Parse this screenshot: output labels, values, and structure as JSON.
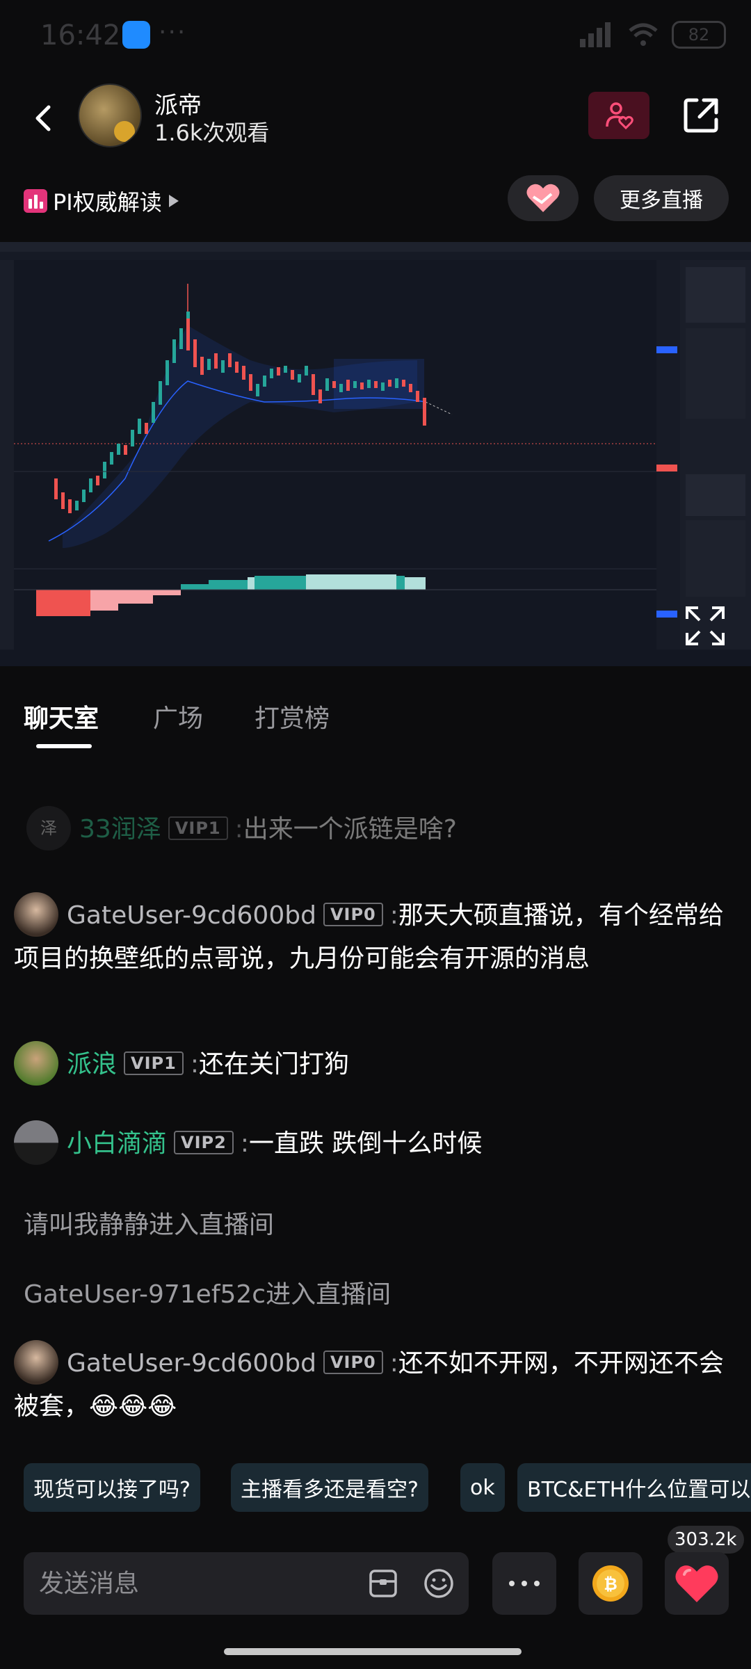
{
  "status_bar": {
    "time": "16:42",
    "more": "···",
    "battery": "82"
  },
  "header": {
    "host_name": "派帝",
    "view_count": "1.6k次观看"
  },
  "topic": {
    "label": "PI权威解读"
  },
  "buttons": {
    "more_live": "更多直播"
  },
  "tabs": [
    "聊天室",
    "广场",
    "打赏榜"
  ],
  "chat": {
    "messages": [
      {
        "avatar_text": "泽",
        "user": "33润泽",
        "vip": "VIP1",
        "sep": ":",
        "text": "出来一个派链是啥?"
      },
      {
        "user": "GateUser-9cd600bd",
        "vip": "VIP0",
        "sep": ":",
        "text": "那天大硕直播说，有个经常给项目的换壁纸的点哥说，九月份可能会有开源的消息"
      },
      {
        "user": "派浪",
        "vip": "VIP1",
        "sep": ":",
        "text": "还在关门打狗"
      },
      {
        "user": "小白滴滴",
        "vip": "VIP2",
        "sep": ":",
        "text": "一直跌 跌倒十么时候"
      },
      {
        "text": "请叫我静静进入直播间"
      },
      {
        "text": "GateUser-971ef52c进入直播间"
      },
      {
        "user": "GateUser-9cd600bd",
        "vip": "VIP0",
        "sep": ":",
        "text": "还不如不开网，不开网还不会被套，😂😂😂"
      }
    ]
  },
  "quick_replies": [
    "现货可以接了吗?",
    "主播看多还是看空?",
    "ok",
    "BTC&ETH什么位置可以"
  ],
  "like_count": "303.2k",
  "composer": {
    "placeholder": "发送消息"
  },
  "colors": {
    "accent_green": "#34c28c",
    "heart_red": "#ff3b5c",
    "chart_up": "#26a69a",
    "chart_down": "#ef5350"
  }
}
